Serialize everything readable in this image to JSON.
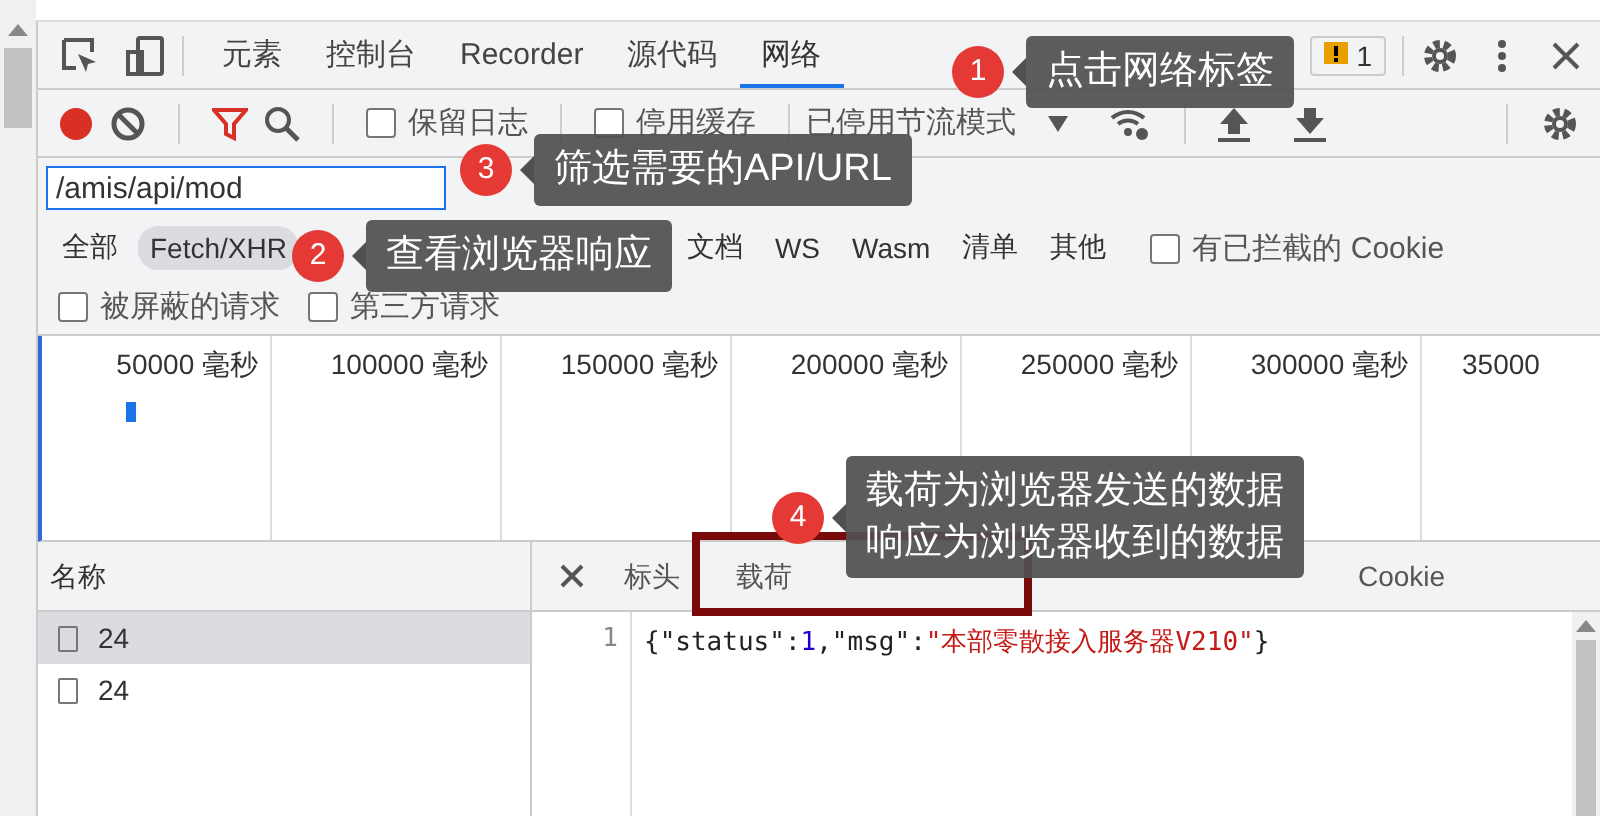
{
  "devtools_tabs": [
    {
      "label": "元素",
      "selected": false
    },
    {
      "label": "控制台",
      "selected": false
    },
    {
      "label": "Recorder",
      "selected": false
    },
    {
      "label": "源代码",
      "selected": false
    },
    {
      "label": "网络",
      "selected": true
    }
  ],
  "issues_count": "1",
  "toolbar": {
    "recording": true,
    "options": [
      {
        "label": "保留日志",
        "checked": false
      },
      {
        "label": "停用缓存",
        "checked": false
      }
    ],
    "throttling": "已停用节流模式"
  },
  "filter": {
    "value": "/amis/api/mod"
  },
  "type_filters": [
    {
      "label": "全部",
      "selected": false
    },
    {
      "label": "Fetch/XHR",
      "selected": true
    },
    {
      "label": "文档",
      "selected": false
    },
    {
      "label": "WS",
      "selected": false
    },
    {
      "label": "Wasm",
      "selected": false
    },
    {
      "label": "清单",
      "selected": false
    },
    {
      "label": "其他",
      "selected": false
    }
  ],
  "blocked_cookies": {
    "label": "有已拦截的 Cookie",
    "checked": false
  },
  "request_filters": [
    {
      "label": "被屏蔽的请求",
      "checked": false
    },
    {
      "label": "第三方请求",
      "checked": false
    }
  ],
  "timeline": {
    "ticks": [
      "50000 毫秒",
      "100000 毫秒",
      "150000 毫秒",
      "200000 毫秒",
      "250000 毫秒",
      "300000 毫秒",
      "35000"
    ]
  },
  "requests": {
    "column": "名称",
    "rows": [
      {
        "name": "24",
        "selected": true
      },
      {
        "name": "24",
        "selected": false
      }
    ]
  },
  "detail_tabs": [
    {
      "label": "标头",
      "selected": false
    },
    {
      "label": "载荷",
      "selected": false
    },
    {
      "label": "Cookie",
      "selected": false
    }
  ],
  "response": {
    "line_number": "1",
    "tokens": [
      {
        "text": "{\"status\":",
        "kind": "punct"
      },
      {
        "text": "1",
        "kind": "number"
      },
      {
        "text": ",\"msg\":",
        "kind": "punct"
      },
      {
        "text": "\"本部零散接入服务器V210\"",
        "kind": "string"
      },
      {
        "text": "}",
        "kind": "punct"
      }
    ]
  },
  "annotations": [
    {
      "number": "1",
      "lines": [
        "点击网络标签"
      ]
    },
    {
      "number": "3",
      "lines": [
        "筛选需要的API/URL"
      ]
    },
    {
      "number": "2",
      "lines": [
        "查看浏览器响应"
      ]
    },
    {
      "number": "4",
      "lines": [
        "载荷为浏览器发送的数据",
        "响应为浏览器收到的数据"
      ]
    }
  ]
}
